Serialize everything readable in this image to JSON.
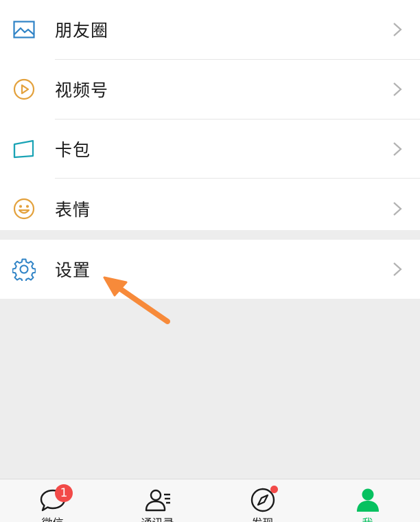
{
  "menu": {
    "items": [
      {
        "label": "朋友圈",
        "icon": "moments-icon"
      },
      {
        "label": "视频号",
        "icon": "channels-play-icon"
      },
      {
        "label": "卡包",
        "icon": "card-wallet-icon"
      },
      {
        "label": "表情",
        "icon": "emoji-smiley-icon"
      },
      {
        "label": "设置",
        "icon": "gear-icon"
      }
    ]
  },
  "tabs": {
    "chats": {
      "label": "微信",
      "badge": "1",
      "icon": "chat-bubble-icon"
    },
    "contacts": {
      "label": "通讯录",
      "icon": "contacts-icon"
    },
    "discover": {
      "label": "发现",
      "icon": "compass-icon",
      "has_dot": true
    },
    "me": {
      "label": "我",
      "icon": "person-icon",
      "active": true
    }
  },
  "colors": {
    "accent_green": "#07c160",
    "badge_red": "#f24a48",
    "arrow_orange": "#f78a3a",
    "icon_blue": "#2f83c6",
    "icon_yellow": "#e3a13c",
    "icon_teal": "#1aa3b5"
  }
}
